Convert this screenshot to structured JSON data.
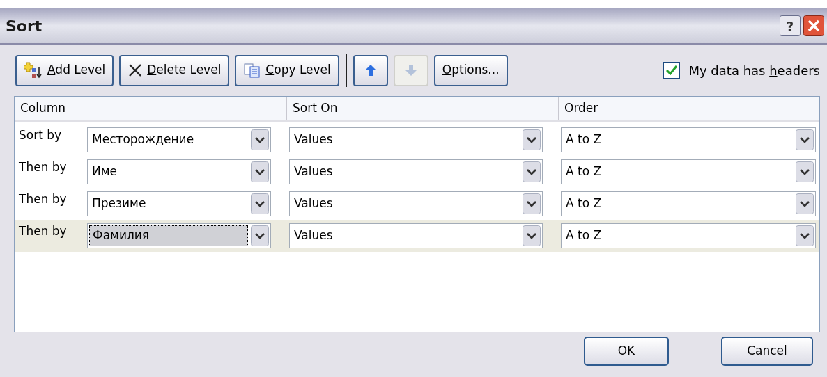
{
  "window": {
    "title": "Sort",
    "help_button": "?"
  },
  "toolbar": [
    {
      "kind": "add",
      "access_key": "A",
      "label_rest": "dd Level",
      "disabled": false
    },
    {
      "kind": "delete",
      "access_key": "D",
      "label_rest": "elete Level",
      "disabled": false
    },
    {
      "kind": "copy",
      "access_key": "C",
      "label_rest": "opy Level",
      "disabled": false
    },
    {
      "kind": "up",
      "disabled": false
    },
    {
      "kind": "down",
      "disabled": true
    },
    {
      "kind": "options",
      "access_key": "O",
      "label_rest": "ptions...",
      "disabled": false
    }
  ],
  "headers_checkbox": {
    "label_start": "My data has ",
    "access_key": "h",
    "label_rest": "eaders",
    "checked": true
  },
  "table": {
    "columns": [
      "Column",
      "Sort On",
      "Order"
    ],
    "rows": [
      {
        "label": "Sort by",
        "column": "Месторождение",
        "sort_on": "Values",
        "order": "A to Z",
        "selected": false
      },
      {
        "label": "Then by",
        "column": "Име",
        "sort_on": "Values",
        "order": "A to Z",
        "selected": false
      },
      {
        "label": "Then by",
        "column": "Презиме",
        "sort_on": "Values",
        "order": "A to Z",
        "selected": false
      },
      {
        "label": "Then by",
        "column": "Фамилия",
        "sort_on": "Values",
        "order": "A to Z",
        "selected": true
      }
    ]
  },
  "buttons": [
    "OK",
    "Cancel"
  ]
}
